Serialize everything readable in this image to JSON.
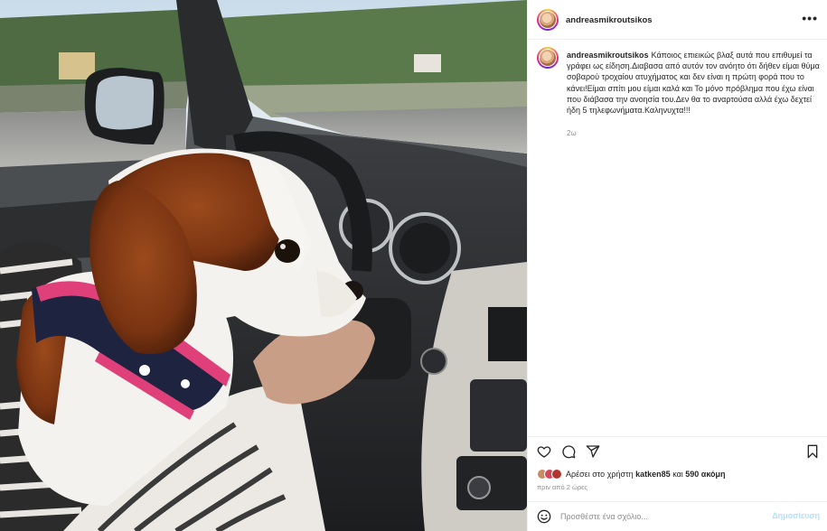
{
  "post": {
    "image_alt": "Cavalier King Charles spaniel in a car",
    "author": "andreasmikroutsikos",
    "more_icon": "more-horizontal-icon",
    "caption": "Κάποιος επιεικώς βλαξ αυτά που επιθυμεί τα γράφει ως είδηση.Διαβασα από αυτόν τον ανόητο ότι δήθεν είμαι θύμα σοβαρού τροχαίου ατυχήματος και δεν είναι η πρώτη φορά που το κάνει!Είμαι σπίτι μου είμαι καλά και Το μόνο πρόβλημα που έχω είναι που διάβασα την ανοησία του.Δεν θα το αναρτούσα αλλά έχω δεχτεί ήδη 5 τηλεφωνήματα.Καληνυχτα!!!",
    "caption_age": "2ω"
  },
  "actions": {
    "like_icon": "heart-icon",
    "comment_icon": "comment-icon",
    "share_icon": "share-icon",
    "save_icon": "bookmark-icon"
  },
  "likes": {
    "prefix": "Αρέσει στο χρήστη ",
    "user": "katken85",
    "middle": " και ",
    "others": "590 ακόμη"
  },
  "timestamp": "πριν από 2 ώρες",
  "comment_box": {
    "emoji_icon": "emoji-icon",
    "placeholder": "Προσθέστε ένα σχόλιο...",
    "post_label": "Δημοσίευση"
  },
  "colors": {
    "accent_disabled": "#b2dffc",
    "text_secondary": "#8e8e8e",
    "border": "#efefef"
  }
}
